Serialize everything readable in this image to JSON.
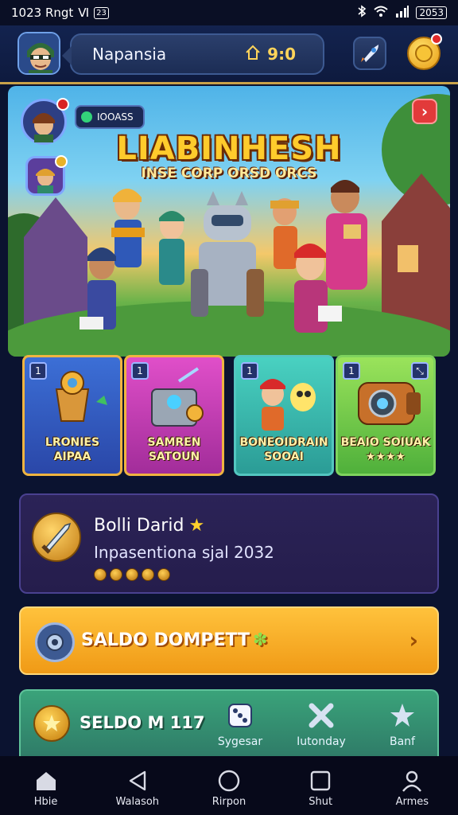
{
  "status_bar": {
    "time": "1023 Rngt",
    "extra": "Ⅵ",
    "box": "23",
    "battery": "2053"
  },
  "header": {
    "player_name": "Napansia",
    "currency_value": "9:0",
    "currency_icon": "home-icon"
  },
  "banner": {
    "title": "LIABINHESH",
    "subtitle": "INSE CORP ORSD ORCS",
    "pill_text": "IOOASS",
    "close_icon": "chevron-right-icon"
  },
  "cards": [
    {
      "num": "1",
      "label_line1": "LRONIES",
      "label_line2": "AIPAA"
    },
    {
      "num": "1",
      "label_line1": "SAMREN",
      "label_line2": "SATOUN"
    },
    {
      "num": "1",
      "label_line1": "BONEOIDRAIN",
      "label_line2": "SOOAI"
    },
    {
      "num": "1",
      "label_line1": "BEAIO SOIUAK",
      "label_line2": "★★★★"
    }
  ],
  "profile": {
    "name": "Bolli Darid",
    "star": "★",
    "info": "Inpasentiona sjal 2032"
  },
  "saldo_dompett": {
    "label": "SALDO DOMPETT",
    "sparkle": "✽",
    "arrow": "›"
  },
  "saldo_bottom": {
    "label": "SELDO M 117",
    "actions": [
      {
        "label": "Sygesar",
        "icon": "dice-icon"
      },
      {
        "label": "Iutonday",
        "icon": "crossed-tools-icon"
      },
      {
        "label": "Banf",
        "icon": "star-icon"
      }
    ]
  },
  "bottom_nav": [
    {
      "label": "Hbie",
      "icon": "home-icon"
    },
    {
      "label": "Walasoh",
      "icon": "back-triangle-icon"
    },
    {
      "label": "Rirpon",
      "icon": "circle-home-icon"
    },
    {
      "label": "Shut",
      "icon": "square-recents-icon"
    },
    {
      "label": "Armes",
      "icon": "person-icon"
    }
  ],
  "colors": {
    "background": "#0b1330",
    "accent_gold": "#f0b440",
    "saldo_orange": "#f09a16",
    "saldo_green": "#2f7c68",
    "profile_panel": "#2b2357"
  }
}
